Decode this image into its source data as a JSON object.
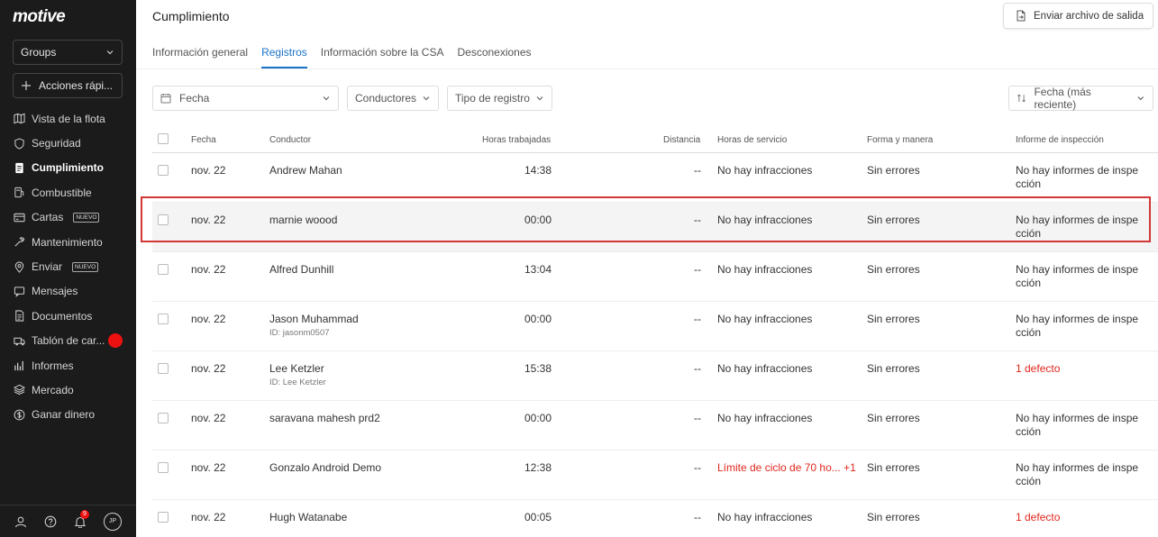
{
  "sidebar": {
    "logo": "motive",
    "groups_label": "Groups",
    "quick_actions_label": "Acciones rápi...",
    "items": [
      {
        "label": "Vista de la flota",
        "icon": "map-icon"
      },
      {
        "label": "Seguridad",
        "icon": "shield-icon"
      },
      {
        "label": "Cumplimiento",
        "icon": "document-icon",
        "active": true
      },
      {
        "label": "Combustible",
        "icon": "fuel-icon"
      },
      {
        "label": "Cartas",
        "icon": "card-icon",
        "badge": "NUEVO"
      },
      {
        "label": "Mantenimiento",
        "icon": "wrench-icon"
      },
      {
        "label": "Enviar",
        "icon": "location-icon",
        "badge": "NUEVO"
      },
      {
        "label": "Mensajes",
        "icon": "message-icon"
      },
      {
        "label": "Documentos",
        "icon": "file-icon"
      },
      {
        "label": "Tablón de car...",
        "icon": "truck-icon"
      },
      {
        "label": "Informes",
        "icon": "chart-icon"
      },
      {
        "label": "Mercado",
        "icon": "layers-icon"
      },
      {
        "label": "Ganar dinero",
        "icon": "dollar-icon"
      }
    ],
    "notification_count": "9",
    "avatar_initials": "JP"
  },
  "header": {
    "title": "Cumplimiento",
    "export_label": "Enviar archivo de salida"
  },
  "tabs": [
    {
      "label": "Información general"
    },
    {
      "label": "Registros",
      "active": true
    },
    {
      "label": "Información sobre la CSA"
    },
    {
      "label": "Desconexiones"
    }
  ],
  "filters": {
    "date_placeholder": "Fecha",
    "drivers_label": "Conductores",
    "log_type_label": "Tipo de registro",
    "sort_label": "Fecha (más reciente)"
  },
  "table": {
    "columns": [
      "Fecha",
      "Conductor",
      "Horas trabajadas",
      "Distancia",
      "Horas de servicio",
      "Forma y manera",
      "Informe de inspección"
    ],
    "rows": [
      {
        "date": "nov. 22",
        "driver": "Andrew Mahan",
        "driver_id": "",
        "hours": "14:38",
        "distance": "--",
        "hos": "No hay infracciones",
        "form": "Sin errores",
        "inspection": "No hay informes de inspección"
      },
      {
        "date": "nov. 22",
        "driver": "marnie woood",
        "driver_id": "",
        "hours": "00:00",
        "distance": "--",
        "hos": "No hay infracciones",
        "form": "Sin errores",
        "inspection": "No hay informes de inspección"
      },
      {
        "date": "nov. 22",
        "driver": "Alfred Dunhill",
        "driver_id": "",
        "hours": "13:04",
        "distance": "--",
        "hos": "No hay infracciones",
        "form": "Sin errores",
        "inspection": "No hay informes de inspección"
      },
      {
        "date": "nov. 22",
        "driver": "Jason Muhammad",
        "driver_id": "ID: jasonm0507",
        "hours": "00:00",
        "distance": "--",
        "hos": "No hay infracciones",
        "form": "Sin errores",
        "inspection": "No hay informes de inspección"
      },
      {
        "date": "nov. 22",
        "driver": "Lee Ketzler",
        "driver_id": "ID: Lee Ketzler",
        "hours": "15:38",
        "distance": "--",
        "hos": "No hay infracciones",
        "form": "Sin errores",
        "inspection": "1 defecto"
      },
      {
        "date": "nov. 22",
        "driver": "saravana mahesh prd2",
        "driver_id": "",
        "hours": "00:00",
        "distance": "--",
        "hos": "No hay infracciones",
        "form": "Sin errores",
        "inspection": "No hay informes de inspección"
      },
      {
        "date": "nov. 22",
        "driver": "Gonzalo Android Demo",
        "driver_id": "",
        "hours": "12:38",
        "distance": "--",
        "hos": "Límite de ciclo de 70 ho... +1",
        "form": "Sin errores",
        "inspection": "No hay informes de inspección"
      },
      {
        "date": "nov. 22",
        "driver": "Hugh Watanabe",
        "driver_id": "",
        "hours": "00:05",
        "distance": "--",
        "hos": "No hay infracciones",
        "form": "Sin errores",
        "inspection": "1 defecto"
      }
    ]
  },
  "colors": {
    "accent": "#1a73c8",
    "error": "#e0271e",
    "sidebar_bg": "#1b1b1b",
    "highlight": "#d23737"
  }
}
